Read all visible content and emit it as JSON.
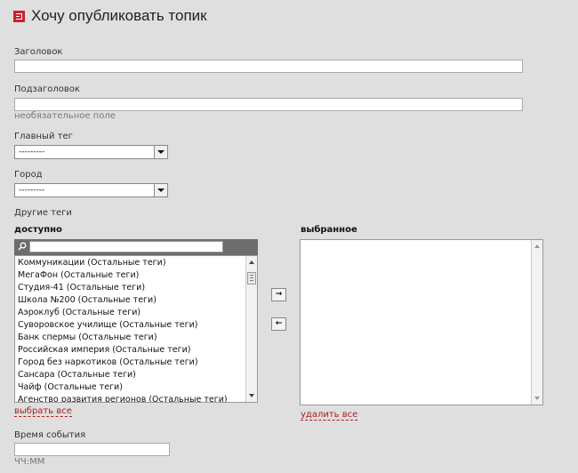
{
  "page_title": "Хочу опубликовать топик",
  "fields": {
    "heading_label": "Заголовок",
    "subheading_label": "Подзаголовок",
    "optional_hint": "необязательное поле",
    "main_tag_label": "Главный тег",
    "main_tag_value": "---------",
    "city_label": "Город",
    "city_value": "---------",
    "other_tags_label": "Другие теги",
    "event_time_label": "Время события",
    "event_time_hint": "ЧЧ:ММ"
  },
  "tags": {
    "available_label": "доступно",
    "selected_label": "выбранное",
    "filter_placeholder": "",
    "available_items": [
      "Коммуникации (Остальные теги)",
      "МегаФон (Остальные теги)",
      "Студия-41 (Остальные теги)",
      "Школа №200 (Остальные теги)",
      "Аэроклуб (Остальные теги)",
      "Суворовское училище (Остальные теги)",
      "Банк спермы (Остальные теги)",
      "Российская империя (Остальные теги)",
      "Город без наркотиков (Остальные теги)",
      "Сансара (Остальные теги)",
      "Чайф (Остальные теги)",
      "Агенство развития регионов (Остальные теги)"
    ],
    "selected_items": [],
    "add_button": "→",
    "remove_button": "←",
    "select_all": "выбрать все",
    "remove_all": "удалить все"
  },
  "colors": {
    "background": "#dfdfdf",
    "accent_red": "#c8232c",
    "link_red": "#b01b1b",
    "filter_bar": "#6d6d6d"
  }
}
